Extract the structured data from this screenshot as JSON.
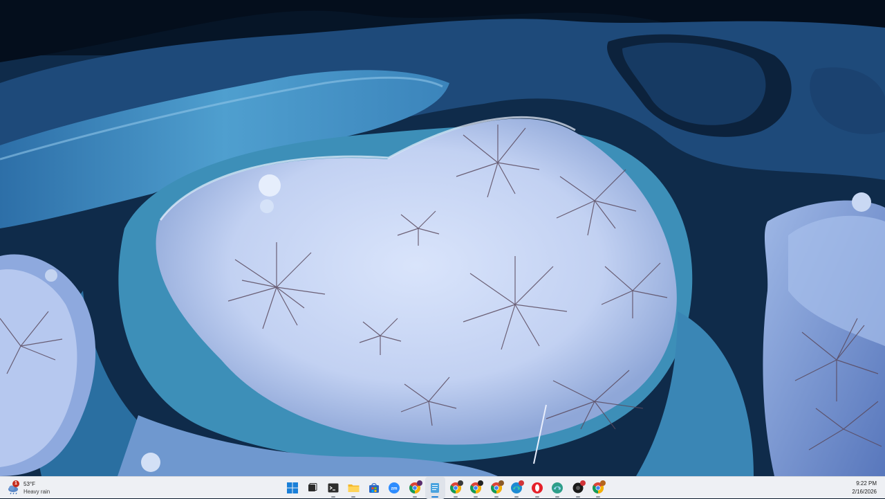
{
  "desktop": {
    "wallpaper": "aerial-frozen-river-island"
  },
  "taskbar": {
    "weather": {
      "temperature": "53°F",
      "condition": "Heavy rain",
      "badge": "1",
      "icon": "cloud-rain-icon"
    },
    "apps": [
      {
        "name": "start-button",
        "icon": "windows-logo-icon"
      },
      {
        "name": "task-view-button",
        "icon": "task-view-icon"
      },
      {
        "name": "terminal-button",
        "icon": "terminal-icon"
      },
      {
        "name": "file-explorer-button",
        "icon": "folder-icon"
      },
      {
        "name": "store-button",
        "icon": "store-icon"
      },
      {
        "name": "zoom-button",
        "icon": "zoom-icon",
        "label": "zm"
      },
      {
        "name": "chrome-profile-1-button",
        "icon": "chrome-icon"
      },
      {
        "name": "notepad-button",
        "icon": "notepad-icon"
      },
      {
        "name": "chrome-profile-2-button",
        "icon": "chrome-icon"
      },
      {
        "name": "chrome-profile-3-button",
        "icon": "chrome-icon"
      },
      {
        "name": "chrome-profile-4-button",
        "icon": "chrome-icon"
      },
      {
        "name": "edge-button",
        "icon": "edge-icon"
      },
      {
        "name": "opera-button",
        "icon": "opera-icon"
      },
      {
        "name": "edge-dev-button",
        "icon": "edge-dev-icon"
      },
      {
        "name": "app-dark-button",
        "icon": "app-icon"
      },
      {
        "name": "chrome-profile-5-button",
        "icon": "chrome-icon"
      }
    ],
    "clock": {
      "time": "9:22 PM",
      "date": "2/16/2026"
    }
  }
}
